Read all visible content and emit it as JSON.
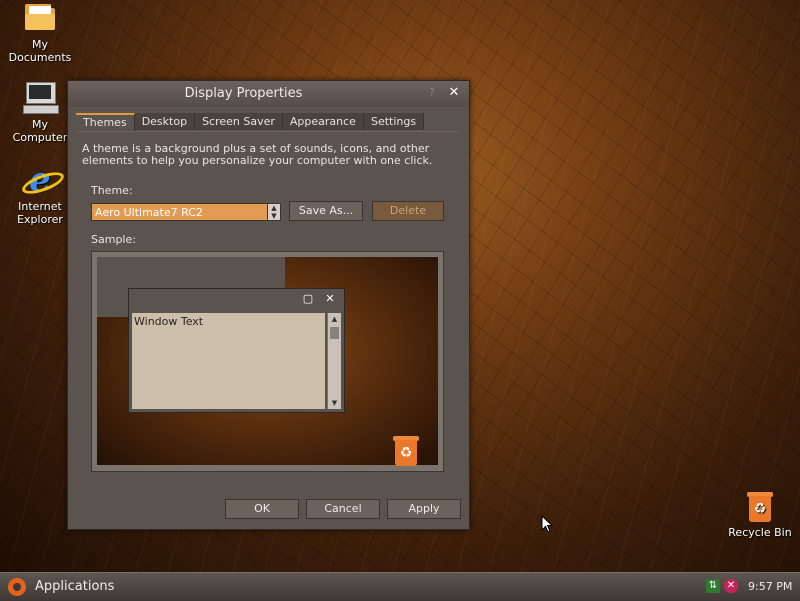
{
  "desktop": {
    "icons": [
      {
        "label_line1": "My",
        "label_line2": "Documents",
        "icon": "folder-icon"
      },
      {
        "label_line1": "My",
        "label_line2": "Computer",
        "icon": "computer-icon"
      },
      {
        "label_line1": "Internet",
        "label_line2": "Explorer",
        "icon": "internet-explorer-icon"
      },
      {
        "label_line1": "Recycle Bin",
        "label_line2": "",
        "icon": "recycle-bin-icon"
      }
    ]
  },
  "dialog": {
    "title": "Display Properties",
    "close_glyph": "✕",
    "help_glyph": "?",
    "tabs": [
      {
        "label": "Themes",
        "active": true
      },
      {
        "label": "Desktop",
        "active": false
      },
      {
        "label": "Screen Saver",
        "active": false
      },
      {
        "label": "Appearance",
        "active": false
      },
      {
        "label": "Settings",
        "active": false
      }
    ],
    "description": "A theme is a background plus a set of sounds, icons, and other elements to help you personalize your computer with one click.",
    "theme_label": "Theme:",
    "theme_value": "Aero Ultimate7 RC2",
    "save_as_label": "Save As...",
    "delete_label": "Delete",
    "sample_label": "Sample:",
    "sample_window_text": "Window Text",
    "ok_label": "OK",
    "cancel_label": "Cancel",
    "apply_label": "Apply"
  },
  "taskbar": {
    "applications_label": "Applications",
    "clock": "9:57 PM"
  },
  "colors": {
    "accent": "#e39a52",
    "dialog_bg": "#5b534d",
    "taskbar_bg": "#4a433d"
  }
}
